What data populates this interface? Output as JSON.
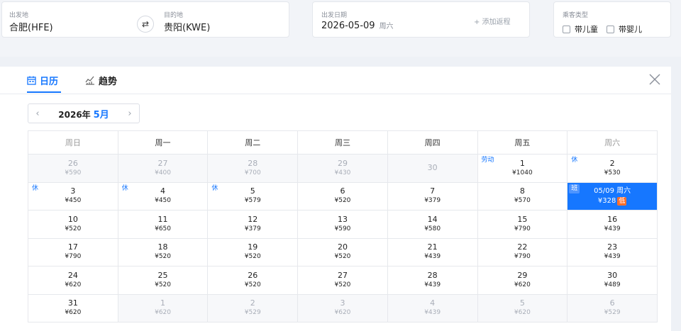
{
  "route": {
    "from_label": "出发地",
    "from_value": "合肥(HFE)",
    "to_label": "目的地",
    "to_value": "贵阳(KWE)",
    "swap_icon": "⇄"
  },
  "date": {
    "label": "出发日期",
    "value": "2026-05-09",
    "weekday": "周六",
    "add_return": "+ 添加返程"
  },
  "passenger": {
    "label": "乘客类型",
    "opt_child": "带儿童",
    "opt_infant": "带婴儿"
  },
  "tabs": {
    "calendar": "日历",
    "trend": "趋势"
  },
  "month_nav": {
    "prev": "‹",
    "next": "›",
    "year": "2026年",
    "month": "5月"
  },
  "calendar": {
    "weekdays": [
      "周日",
      "周一",
      "周二",
      "周三",
      "周四",
      "周五",
      "周六"
    ],
    "weeks": [
      [
        {
          "day": "26",
          "price": "¥590",
          "state": "past"
        },
        {
          "day": "27",
          "price": "¥400",
          "state": "past"
        },
        {
          "day": "28",
          "price": "¥700",
          "state": "past"
        },
        {
          "day": "29",
          "price": "¥430",
          "state": "past"
        },
        {
          "day": "30",
          "price": "",
          "state": "past"
        },
        {
          "day": "1",
          "price": "¥1040",
          "state": "normal",
          "tag": "劳动"
        },
        {
          "day": "2",
          "price": "¥530",
          "state": "normal",
          "tag": "休"
        }
      ],
      [
        {
          "day": "3",
          "price": "¥450",
          "state": "normal",
          "tag": "休"
        },
        {
          "day": "4",
          "price": "¥450",
          "state": "normal",
          "tag": "休"
        },
        {
          "day": "5",
          "price": "¥579",
          "state": "normal",
          "tag": "休"
        },
        {
          "day": "6",
          "price": "¥520",
          "state": "normal"
        },
        {
          "day": "7",
          "price": "¥379",
          "state": "normal"
        },
        {
          "day": "8",
          "price": "¥570",
          "state": "normal"
        },
        {
          "day": "05/09 周六",
          "price": "¥328",
          "state": "selected",
          "tag": "班",
          "badge": "低"
        }
      ],
      [
        {
          "day": "10",
          "price": "¥520",
          "state": "normal"
        },
        {
          "day": "11",
          "price": "¥650",
          "state": "normal"
        },
        {
          "day": "12",
          "price": "¥379",
          "state": "normal"
        },
        {
          "day": "13",
          "price": "¥590",
          "state": "normal"
        },
        {
          "day": "14",
          "price": "¥580",
          "state": "normal"
        },
        {
          "day": "15",
          "price": "¥790",
          "state": "normal"
        },
        {
          "day": "16",
          "price": "¥439",
          "state": "normal"
        }
      ],
      [
        {
          "day": "17",
          "price": "¥790",
          "state": "normal"
        },
        {
          "day": "18",
          "price": "¥520",
          "state": "normal"
        },
        {
          "day": "19",
          "price": "¥520",
          "state": "normal"
        },
        {
          "day": "20",
          "price": "¥520",
          "state": "normal"
        },
        {
          "day": "21",
          "price": "¥439",
          "state": "normal"
        },
        {
          "day": "22",
          "price": "¥790",
          "state": "normal"
        },
        {
          "day": "23",
          "price": "¥439",
          "state": "normal"
        }
      ],
      [
        {
          "day": "24",
          "price": "¥620",
          "state": "normal"
        },
        {
          "day": "25",
          "price": "¥520",
          "state": "normal"
        },
        {
          "day": "26",
          "price": "¥520",
          "state": "normal"
        },
        {
          "day": "27",
          "price": "¥520",
          "state": "normal"
        },
        {
          "day": "28",
          "price": "¥439",
          "state": "normal"
        },
        {
          "day": "29",
          "price": "¥620",
          "state": "normal"
        },
        {
          "day": "30",
          "price": "¥489",
          "state": "normal"
        }
      ],
      [
        {
          "day": "31",
          "price": "¥620",
          "state": "normal"
        },
        {
          "day": "1",
          "price": "¥620",
          "state": "other"
        },
        {
          "day": "2",
          "price": "¥529",
          "state": "other"
        },
        {
          "day": "3",
          "price": "¥620",
          "state": "other"
        },
        {
          "day": "4",
          "price": "¥439",
          "state": "other"
        },
        {
          "day": "5",
          "price": "¥620",
          "state": "other"
        },
        {
          "day": "6",
          "price": "¥529",
          "state": "other"
        }
      ]
    ]
  },
  "colors": {
    "accent": "#1677ff",
    "low_badge": "#ff6f2c",
    "past_bg": "#f7f8fa"
  }
}
